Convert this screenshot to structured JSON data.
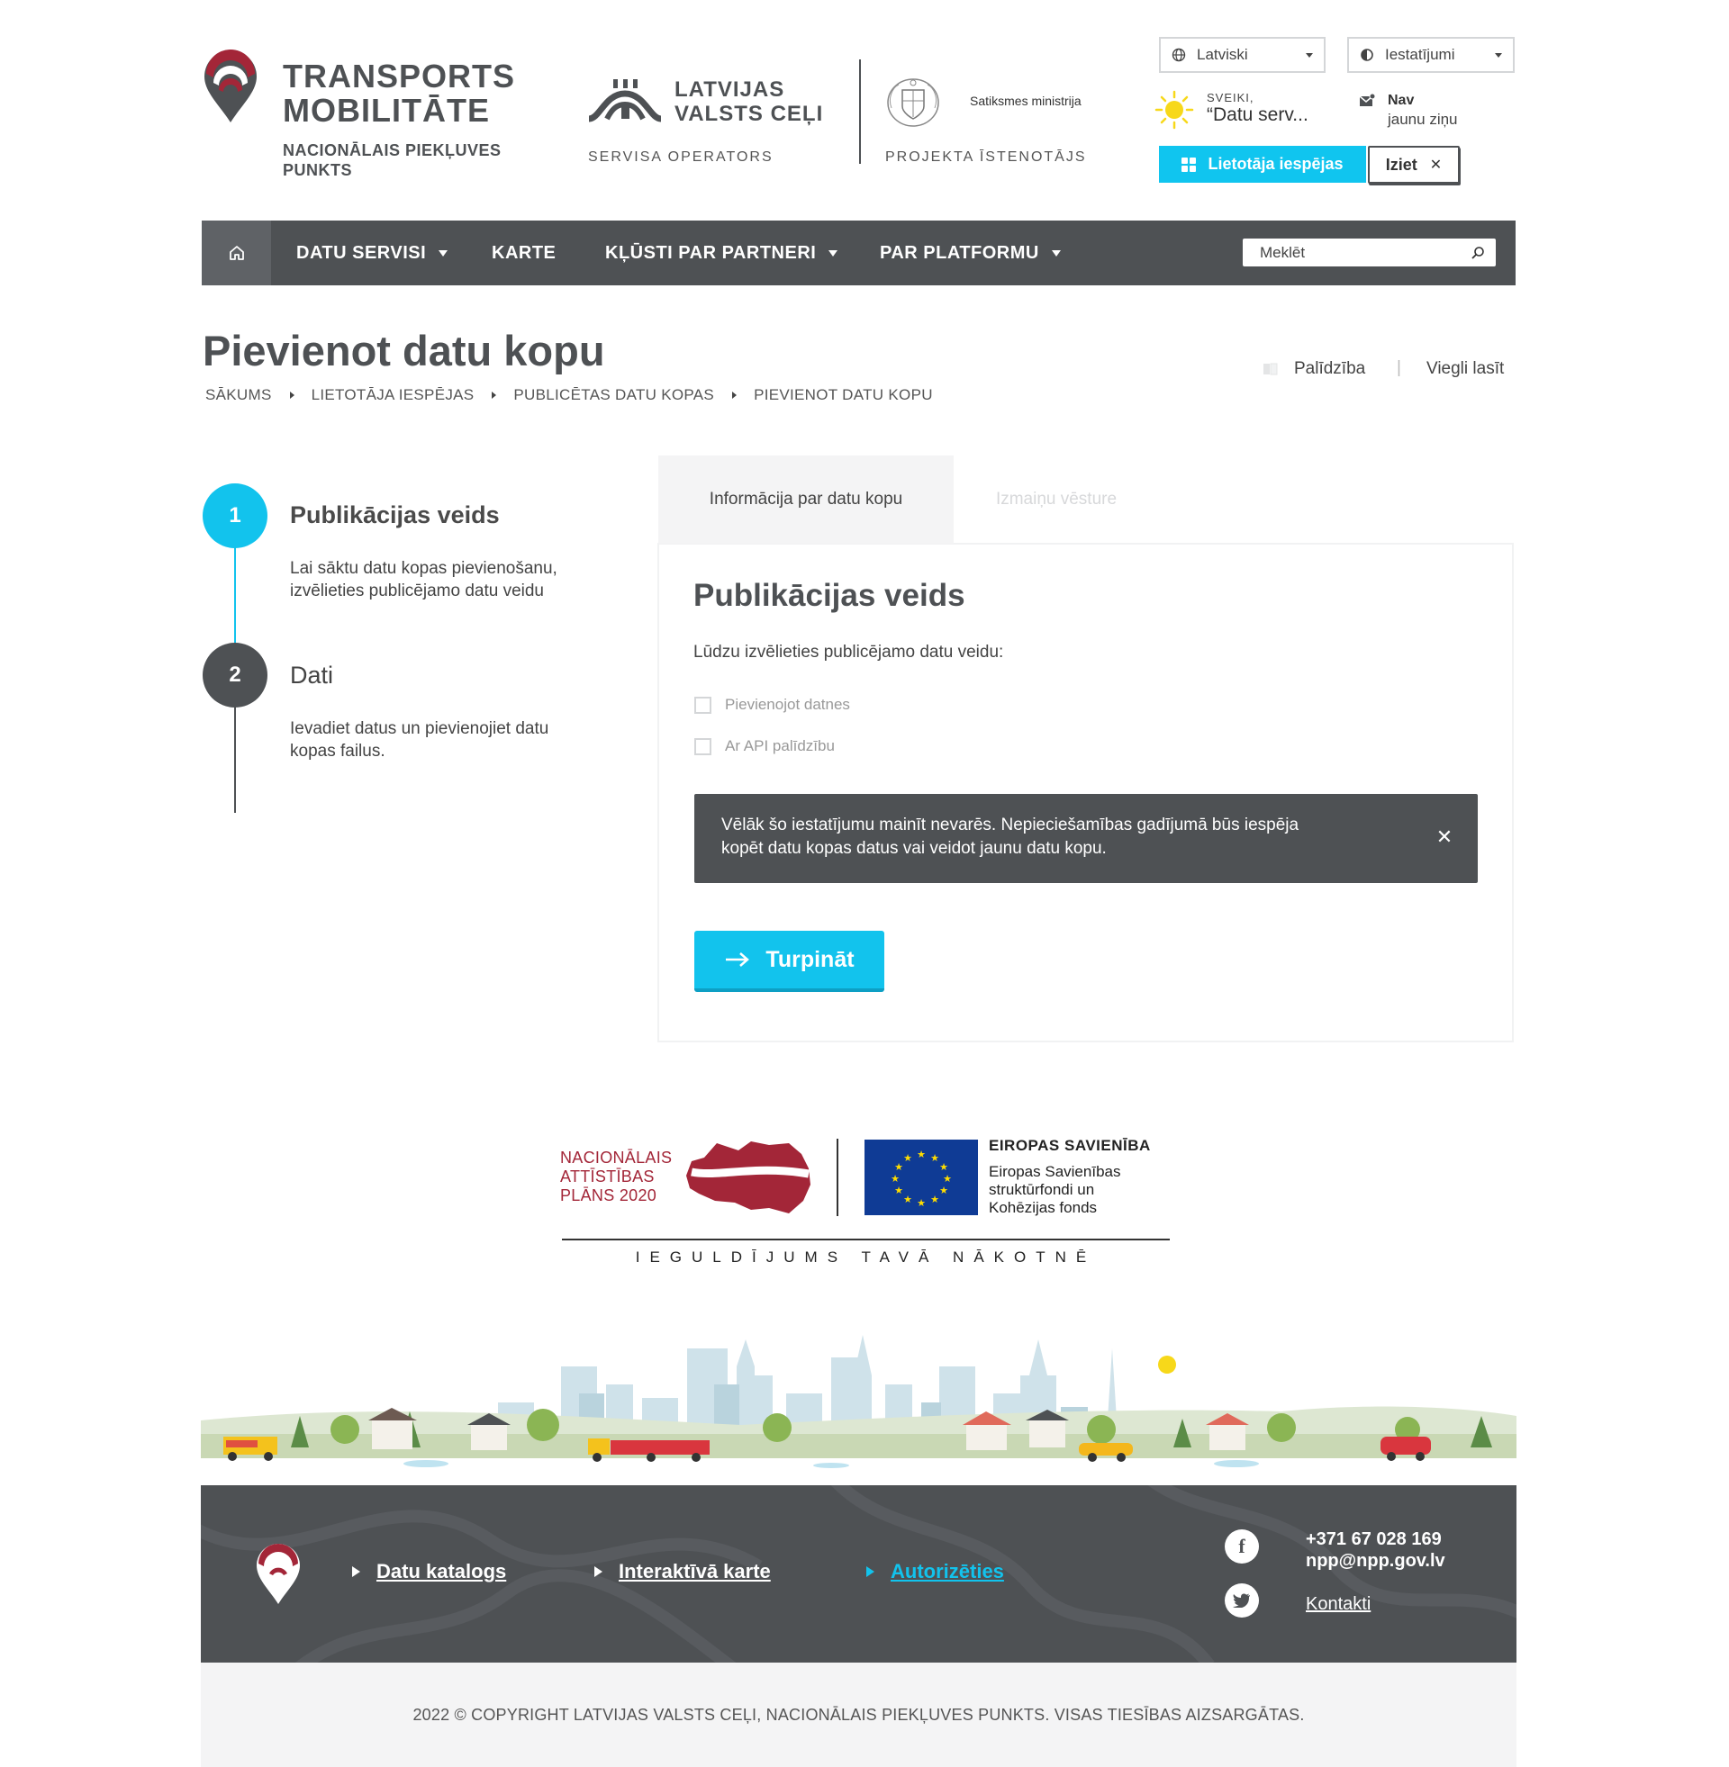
{
  "header": {
    "brand_title_line1": "TRANSPORTS",
    "brand_title_line2": "MOBILITĀTE",
    "brand_sub_line1": "NACIONĀLAIS PIEKĻUVES",
    "brand_sub_line2": "PUNKTS",
    "lvc_line1": "LATVIJAS",
    "lvc_line2": "VALSTS CEĻI",
    "lvc_role": "SERVISA OPERATORS",
    "ministry_name": "Satiksmes ministrija",
    "ministry_role": "PROJEKTA ĪSTENOTĀJS",
    "language": "Latviski",
    "settings": "Iestatījumi",
    "greeting_label": "SVEIKI,",
    "greeting_name": "“Datu serv...",
    "messages_title": "Nav",
    "messages_sub": "jaunu ziņu",
    "user_options_button": "Lietotāja iespējas",
    "logout_button": "Iziet"
  },
  "nav": {
    "items": [
      "DATU SERVISI",
      "KARTE",
      "KĻŪSTI PAR PARTNERI",
      "PAR PLATFORMU"
    ],
    "search_placeholder": "Meklēt"
  },
  "page": {
    "title": "Pievienot datu kopu",
    "help": "Palīdzība",
    "easy_read": "Viegli lasīt",
    "breadcrumb": [
      "SĀKUMS",
      "LIETOTĀJA IESPĒJAS",
      "PUBLICĒTAS DATU KOPAS",
      "PIEVIENOT DATU KOPU"
    ]
  },
  "steps": [
    {
      "number": "1",
      "title": "Publikācijas veids",
      "desc_line1": "Lai sāktu datu kopas pievienošanu,",
      "desc_line2": "izvēlieties publicējamo datu veidu"
    },
    {
      "number": "2",
      "title": "Dati",
      "desc_line1": "Ievadiet datus un pievienojiet datu",
      "desc_line2": "kopas failus."
    }
  ],
  "card": {
    "tabs": [
      "Informācija par datu kopu",
      "Izmaiņu vēsture"
    ],
    "section_title": "Publikācijas veids",
    "prompt": "Lūdzu izvēlieties publicējamo datu veidu:",
    "options": [
      "Pievienojot datnes",
      "Ar API palīdzību"
    ],
    "notice_line1": "Vēlāk šo iestatījumu mainīt nevarēs. Nepieciešamības gadījumā būs iespēja",
    "notice_line2": "kopēt datu kopas datus vai veidot jaunu datu kopu.",
    "continue_button": "Turpināt"
  },
  "funding": {
    "nap_line1": "NACIONĀLAIS",
    "nap_line2": "ATTĪSTĪBAS",
    "nap_line3": "PLĀNS 2020",
    "eu_title": "EIROPAS SAVIENĪBA",
    "eu_line1": "Eiropas Savienības",
    "eu_line2": "struktūrfondi un",
    "eu_line3": "Kohēzijas fonds",
    "motto": "IEGULDĪJUMS TAVĀ NĀKOTNĒ"
  },
  "footer": {
    "links": [
      "Datu katalogs",
      "Interaktīvā karte",
      "Autorizēties"
    ],
    "phone": "+371 67 028 169",
    "email": "npp@npp.gov.lv",
    "contacts": "Kontakti",
    "copyright": "2022 © COPYRIGHT LATVIJAS VALSTS CEĻI, NACIONĀLAIS PIEKĻUVES PUNKTS. VISAS TIESĪBAS AIZSARGĀTAS."
  },
  "colors": {
    "accent": "#12c3ed",
    "dark": "#4e5154",
    "brand_red": "#a32638"
  }
}
